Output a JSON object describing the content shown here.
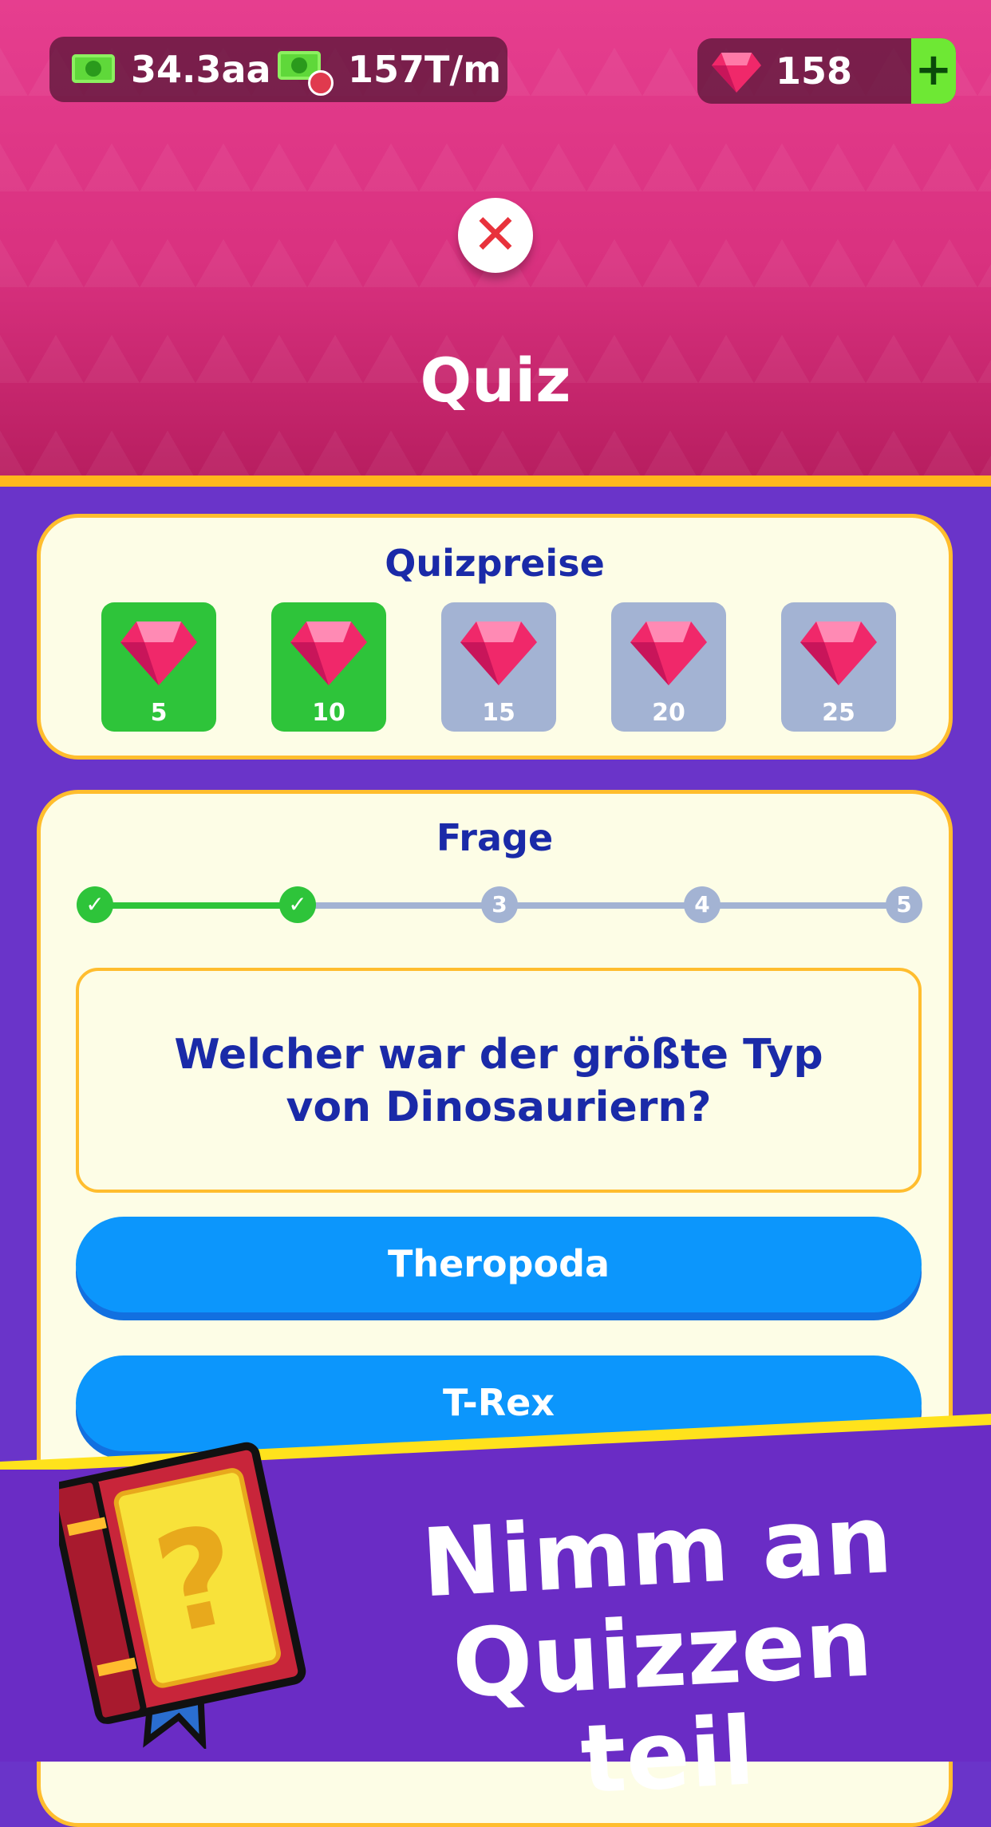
{
  "header": {
    "cash_amount": "34.3aa",
    "income_rate": "157T/m",
    "gem_count": "158",
    "plus_label": "+",
    "close_glyph": "✕",
    "title": "Quiz"
  },
  "prizes": {
    "title": "Quizpreise",
    "items": [
      {
        "value": "5",
        "earned": true
      },
      {
        "value": "10",
        "earned": true
      },
      {
        "value": "15",
        "earned": false
      },
      {
        "value": "20",
        "earned": false
      },
      {
        "value": "25",
        "earned": false
      }
    ]
  },
  "question": {
    "title": "Frage",
    "steps": [
      {
        "label": "✓",
        "done": true
      },
      {
        "label": "✓",
        "done": true
      },
      {
        "label": "3",
        "done": false
      },
      {
        "label": "4",
        "done": false
      },
      {
        "label": "5",
        "done": false
      }
    ],
    "text_line1": "Welcher war der größte Typ",
    "text_line2": "von Dinosauriern?",
    "answers": [
      "Theropoda",
      "T-Rex"
    ]
  },
  "promo": {
    "line1": "Nimm an",
    "line2": "Quizzen teil",
    "book_glyph": "?"
  },
  "icons": [
    "cash-icon",
    "income-cash-icon",
    "clock-icon",
    "gem-icon",
    "plus-icon",
    "close-icon",
    "check-icon",
    "question-book-icon"
  ],
  "colors": {
    "header": "#d9317f",
    "background": "#6a34c9",
    "card": "#fdfde6",
    "card_border": "#ffbd2e",
    "earned": "#2ec43a",
    "locked": "#a3b3d3",
    "answer": "#0c96fc",
    "title_text": "#1a2aa8",
    "gem": "#f0286a"
  }
}
